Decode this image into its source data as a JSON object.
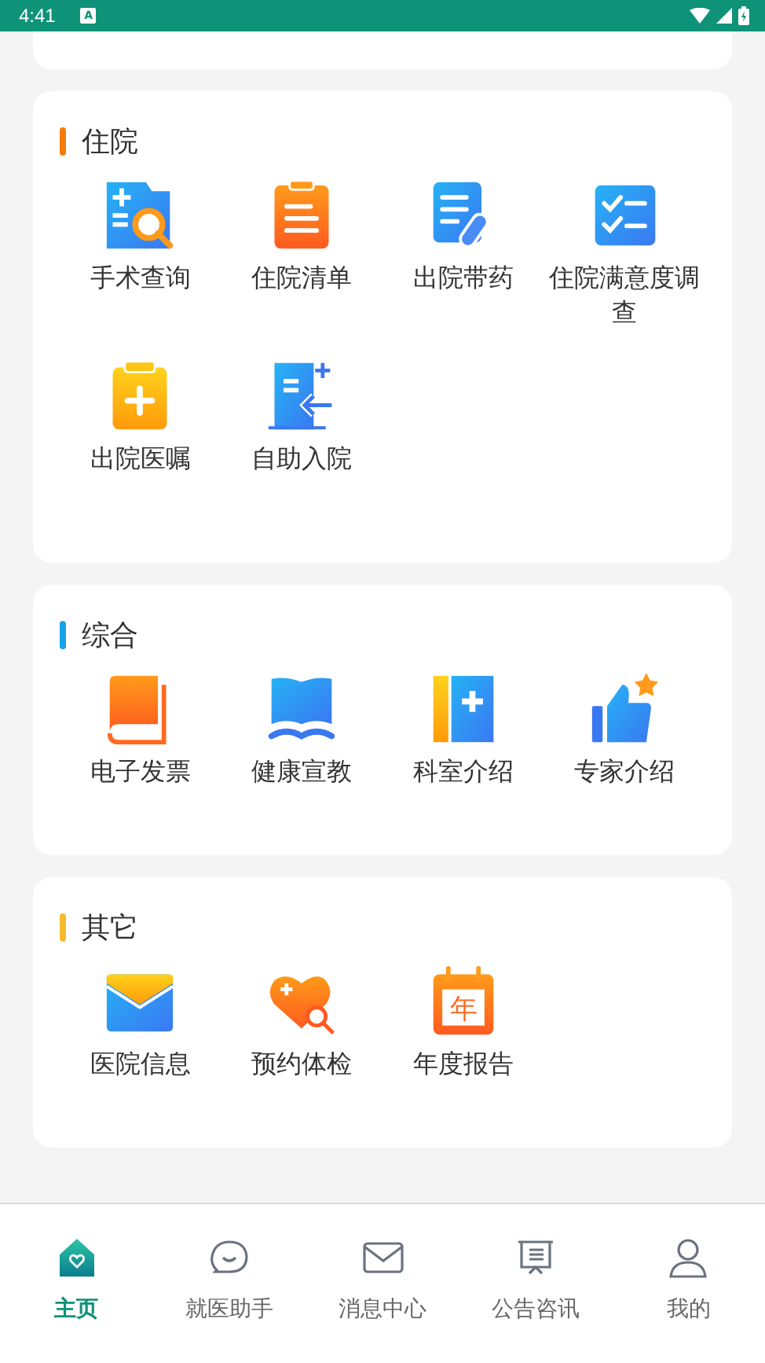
{
  "status_bar": {
    "time": "4:41",
    "notification_badge": "A"
  },
  "sections": [
    {
      "title": "住院",
      "color": "#f57c0c",
      "items": [
        {
          "label": "手术查询"
        },
        {
          "label": "住院清单"
        },
        {
          "label": "出院带药"
        },
        {
          "label": "住院满意度调查"
        },
        {
          "label": "出院医嘱"
        },
        {
          "label": "自助入院"
        }
      ]
    },
    {
      "title": "综合",
      "color": "#17a2e6",
      "items": [
        {
          "label": "电子发票"
        },
        {
          "label": "健康宣教"
        },
        {
          "label": "科室介绍"
        },
        {
          "label": "专家介绍"
        }
      ]
    },
    {
      "title": "其它",
      "color": "#f7b92d",
      "items": [
        {
          "label": "医院信息"
        },
        {
          "label": "预约体检"
        },
        {
          "label": "年度报告",
          "icon_label": "年"
        }
      ]
    }
  ],
  "bottom_nav": [
    {
      "label": "主页",
      "selected": true
    },
    {
      "label": "就医助手",
      "selected": false
    },
    {
      "label": "消息中心",
      "selected": false
    },
    {
      "label": "公告咨讯",
      "selected": false
    },
    {
      "label": "我的",
      "selected": false
    }
  ]
}
